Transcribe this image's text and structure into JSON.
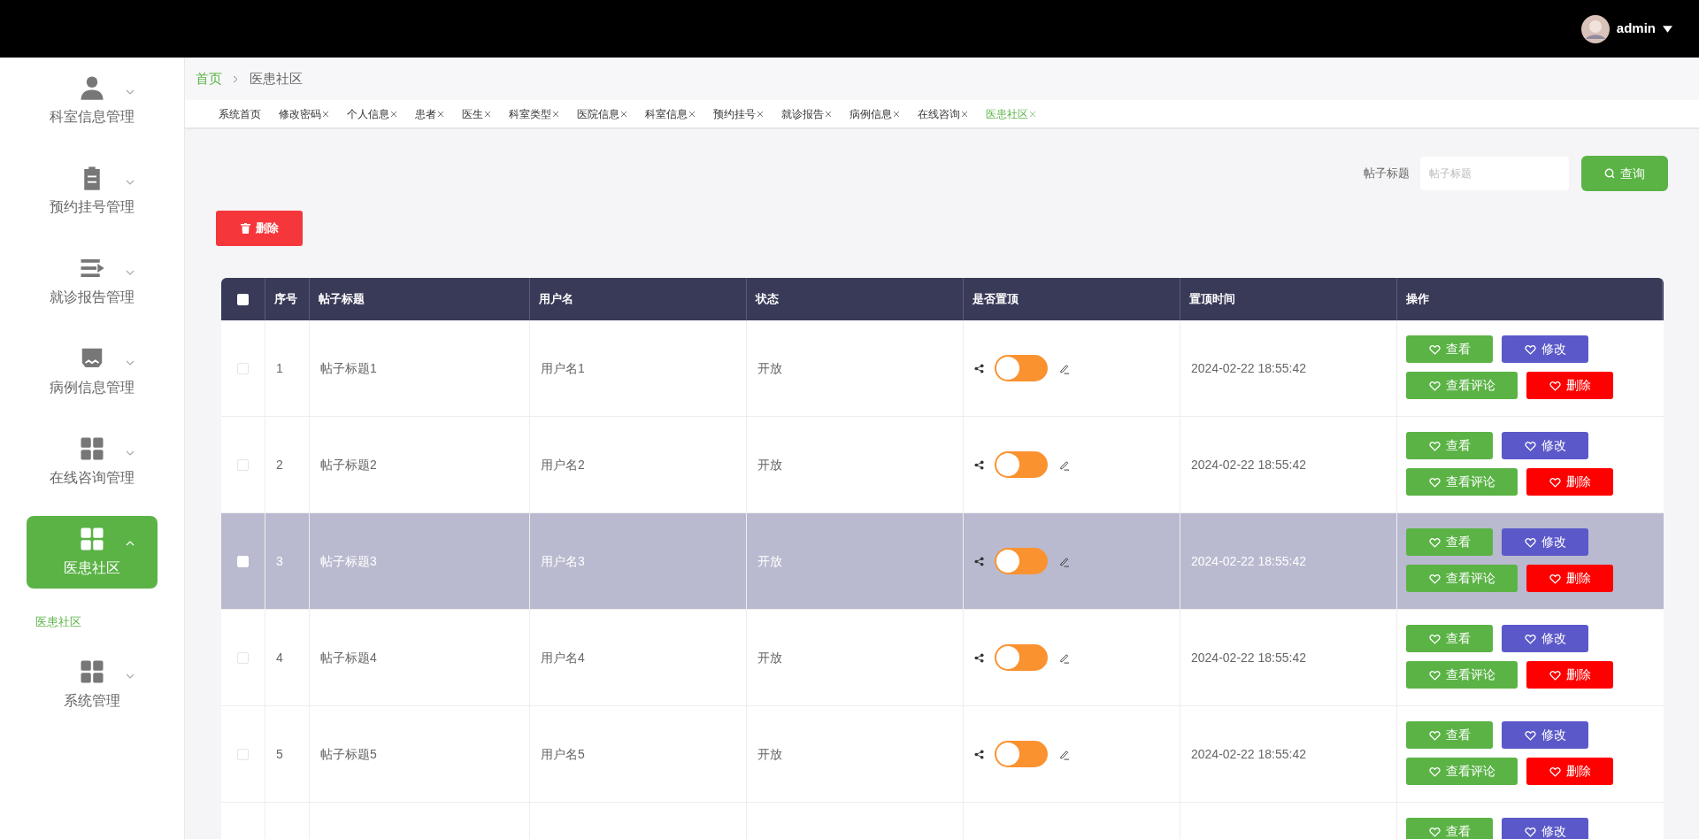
{
  "header": {
    "user": "admin"
  },
  "sidebar": {
    "items": [
      {
        "label": "科室信息管理",
        "kind": "person",
        "expanded": false,
        "selected": false
      },
      {
        "label": "预约挂号管理",
        "kind": "clipboard",
        "expanded": false,
        "selected": false
      },
      {
        "label": "就诊报告管理",
        "kind": "list",
        "expanded": false,
        "selected": false
      },
      {
        "label": "病例信息管理",
        "kind": "tray",
        "expanded": false,
        "selected": false
      },
      {
        "label": "在线咨询管理",
        "kind": "grid",
        "expanded": false,
        "selected": false
      },
      {
        "label": "医患社区",
        "kind": "grid",
        "expanded": true,
        "selected": true,
        "children": [
          {
            "label": "医患社区",
            "selected": true
          }
        ]
      },
      {
        "label": "系统管理",
        "kind": "grid",
        "expanded": false,
        "selected": false
      }
    ]
  },
  "breadcrumb": [
    "首页",
    "医患社区"
  ],
  "tabs": [
    {
      "label": "系统首页",
      "closable": false,
      "selected": false
    },
    {
      "label": "修改密码",
      "closable": true,
      "selected": false
    },
    {
      "label": "个人信息",
      "closable": true,
      "selected": false
    },
    {
      "label": "患者",
      "closable": true,
      "selected": false
    },
    {
      "label": "医生",
      "closable": true,
      "selected": false
    },
    {
      "label": "科室类型",
      "closable": true,
      "selected": false
    },
    {
      "label": "医院信息",
      "closable": true,
      "selected": false
    },
    {
      "label": "科室信息",
      "closable": true,
      "selected": false
    },
    {
      "label": "预约挂号",
      "closable": true,
      "selected": false
    },
    {
      "label": "就诊报告",
      "closable": true,
      "selected": false
    },
    {
      "label": "病例信息",
      "closable": true,
      "selected": false
    },
    {
      "label": "在线咨询",
      "closable": true,
      "selected": false
    },
    {
      "label": "医患社区",
      "closable": true,
      "selected": true
    }
  ],
  "search": {
    "label": "帖子标题",
    "placeholder": "帖子标题",
    "button": "查询"
  },
  "delete_button": "删除",
  "table": {
    "all_checked": false,
    "columns": [
      "序号",
      "帖子标题",
      "用户名",
      "状态",
      "是否置顶",
      "置顶时间",
      "操作"
    ],
    "rows": [
      {
        "selected": false,
        "checked": false,
        "no": "1",
        "title": "帖子标题1",
        "user": "用户名1",
        "status": "开放",
        "on": false,
        "time": "2024-02-22 18:55:42",
        "actions": [
          "查看",
          "修改",
          "查看评论",
          "删除"
        ]
      },
      {
        "selected": false,
        "checked": false,
        "no": "2",
        "title": "帖子标题2",
        "user": "用户名2",
        "status": "开放",
        "on": false,
        "time": "2024-02-22 18:55:42",
        "actions": [
          "查看",
          "修改",
          "查看评论",
          "删除"
        ]
      },
      {
        "selected": true,
        "checked": false,
        "no": "3",
        "title": "帖子标题3",
        "user": "用户名3",
        "status": "开放",
        "on": false,
        "time": "2024-02-22 18:55:42",
        "actions": [
          "查看",
          "修改",
          "查看评论",
          "删除"
        ]
      },
      {
        "selected": false,
        "checked": false,
        "no": "4",
        "title": "帖子标题4",
        "user": "用户名4",
        "status": "开放",
        "on": false,
        "time": "2024-02-22 18:55:42",
        "actions": [
          "查看",
          "修改",
          "查看评论",
          "删除"
        ]
      },
      {
        "selected": false,
        "checked": false,
        "no": "5",
        "title": "帖子标题5",
        "user": "用户名5",
        "status": "开放",
        "on": false,
        "time": "2024-02-22 18:55:42",
        "actions": [
          "查看",
          "修改",
          "查看评论",
          "删除"
        ]
      },
      {
        "selected": false,
        "actions": [
          "查看",
          "修改"
        ]
      }
    ]
  }
}
